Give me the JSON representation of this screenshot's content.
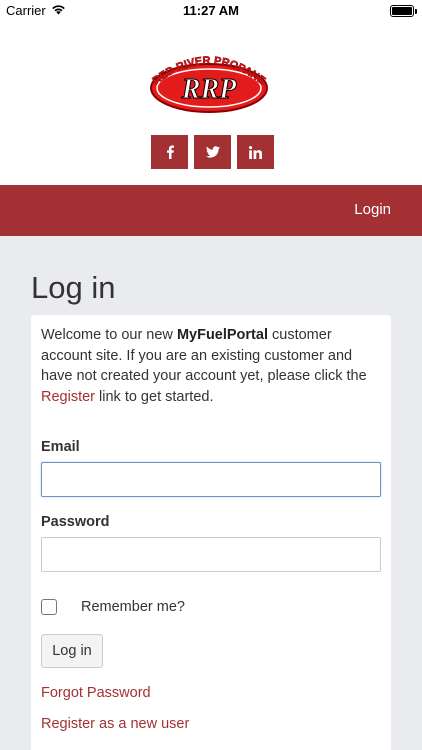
{
  "status_bar": {
    "carrier": "Carrier",
    "time": "11:27 AM"
  },
  "header": {
    "logo_text_top": "RED RIVER PROPANE",
    "logo_text_main": "RRP",
    "brand_color": "#a33134",
    "social": [
      {
        "icon": "facebook-icon",
        "glyph": "f"
      },
      {
        "icon": "twitter-icon",
        "glyph": "t"
      },
      {
        "icon": "linkedin-icon",
        "glyph": "in"
      }
    ]
  },
  "navbar": {
    "login_label": "Login"
  },
  "page": {
    "title": "Log in",
    "intro": {
      "part1": "Welcome to our new ",
      "brand": "MyFuelPortal",
      "part2": " customer account site. If you are an existing customer and have not created your account yet, please click the ",
      "register_link": "Register",
      "part3": " link to get started."
    },
    "form": {
      "email_label": "Email",
      "email_value": "",
      "password_label": "Password",
      "password_value": "",
      "remember_label": "Remember me?",
      "submit_label": "Log in",
      "forgot_link": "Forgot Password",
      "register_new_link": "Register as a new user"
    }
  }
}
